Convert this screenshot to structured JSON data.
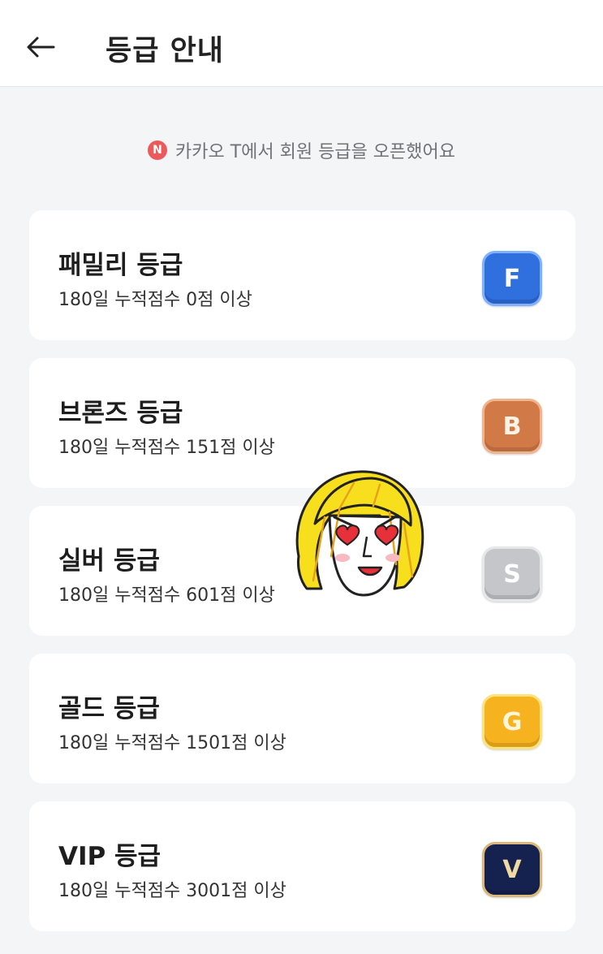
{
  "header": {
    "title": "등급 안내",
    "back_icon": "arrow-left-icon"
  },
  "notice": {
    "badge": "N",
    "text": "카카오 T에서 회원 등급을 오픈했어요"
  },
  "tiers": [
    {
      "title": "패밀리 등급",
      "desc": "180일 누적점수 0점 이상",
      "badge_letter": "F",
      "badge_color": "#2f6fde",
      "badge_border": "#7fb1ff",
      "letter_color": "#ffffff"
    },
    {
      "title": "브론즈 등급",
      "desc": "180일 누적점수 151점 이상",
      "badge_letter": "B",
      "badge_color": "#d27a47",
      "badge_border": "#f0b58f",
      "letter_color": "#fff3e6"
    },
    {
      "title": "실버 등급",
      "desc": "180일 누적점수 601점 이상",
      "badge_letter": "S",
      "badge_color": "#c4c6ca",
      "badge_border": "#e6e7e9",
      "letter_color": "#ffffff"
    },
    {
      "title": "골드 등급",
      "desc": "180일 누적점수 1501점 이상",
      "badge_letter": "G",
      "badge_color": "#f6b31f",
      "badge_border": "#ffe27a",
      "letter_color": "#fff6dc"
    },
    {
      "title": "VIP 등급",
      "desc": "180일 누적점수 3001점 이상",
      "badge_letter": "V",
      "badge_color": "#15224f",
      "badge_border": "#d9b878",
      "letter_color": "#f0d9a2"
    }
  ]
}
